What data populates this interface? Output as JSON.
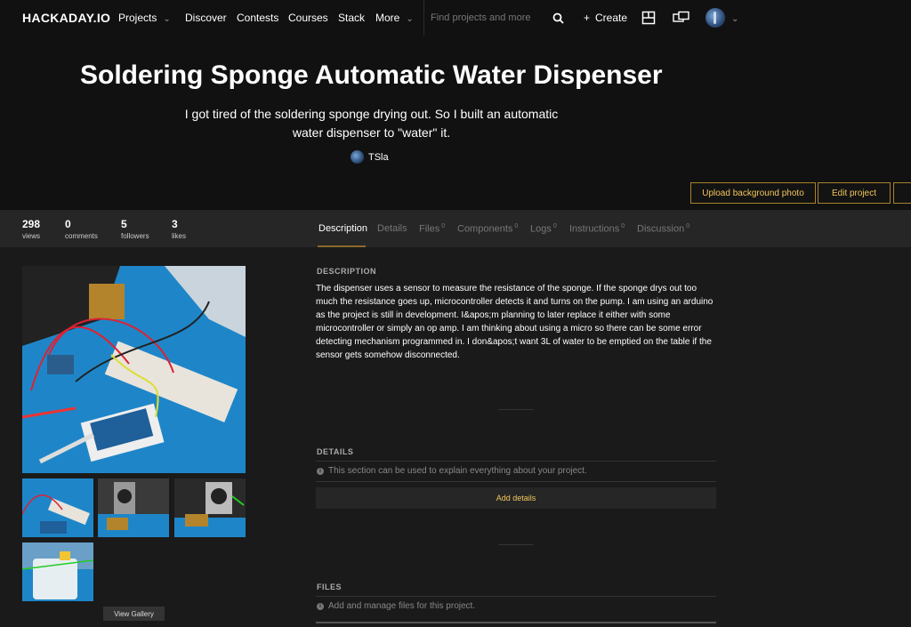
{
  "nav": {
    "logo": "HACKADAY.IO",
    "items": [
      "Projects",
      "Discover",
      "Contests",
      "Courses",
      "Stack",
      "More"
    ],
    "search_placeholder": "Find projects and more",
    "create_label": "Create"
  },
  "hero": {
    "title": "Soldering Sponge Automatic Water Dispenser",
    "subtitle": "I got tired of the soldering sponge drying out. So I built an automatic water dispenser to \"water\" it.",
    "author": "TSla",
    "buttons": [
      "Upload background photo",
      "Edit project"
    ]
  },
  "stats": [
    {
      "value": "298",
      "label": "views"
    },
    {
      "value": "0",
      "label": "comments"
    },
    {
      "value": "5",
      "label": "followers"
    },
    {
      "value": "3",
      "label": "likes"
    }
  ],
  "tabs": [
    {
      "label": "Description",
      "count": ""
    },
    {
      "label": "Details",
      "count": ""
    },
    {
      "label": "Files",
      "count": "0"
    },
    {
      "label": "Components",
      "count": "0"
    },
    {
      "label": "Logs",
      "count": "0"
    },
    {
      "label": "Instructions",
      "count": "0"
    },
    {
      "label": "Discussion",
      "count": "0"
    }
  ],
  "gallery": {
    "view_label": "View Gallery"
  },
  "description": {
    "title": "DESCRIPTION",
    "text": "The dispenser uses a sensor to measure the resistance of the sponge. If the sponge drys out too much the resistance goes up, microcontroller detects it and turns on the pump. I am using an arduino as the project is still in development. I&apos;m planning to later replace it either with some microcontroller or simply an op amp. I am thinking about using a micro so there can be some error detecting mechanism programmed in. I don&apos;t want 3L of water to be emptied on the table if the sensor gets somehow disconnected."
  },
  "details": {
    "title": "DETAILS",
    "hint": "This section can be used to explain everything about your project.",
    "button": "Add details"
  },
  "files": {
    "title": "FILES",
    "hint": "Add and manage files for this project."
  },
  "colors": {
    "accent": "#f3c65b",
    "background": "#1a1a1a",
    "header": "#111111"
  }
}
